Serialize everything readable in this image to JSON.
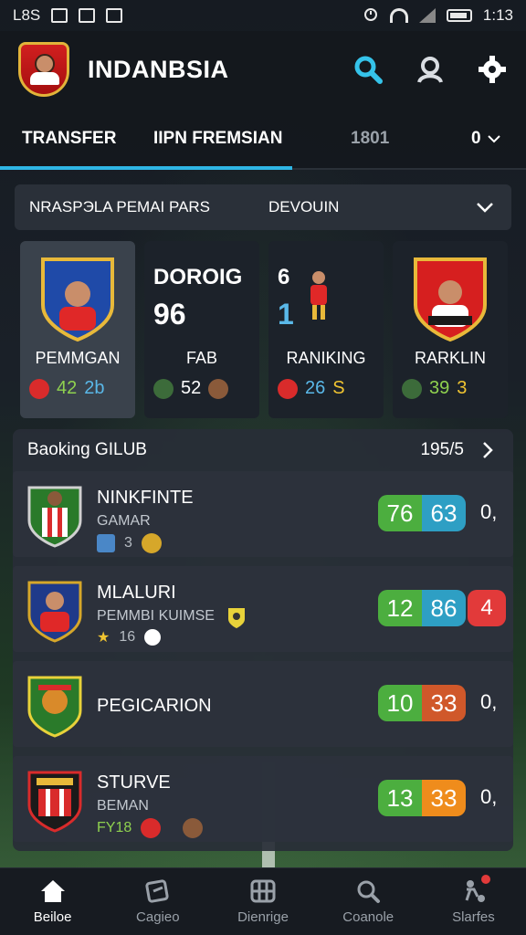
{
  "status_bar": {
    "left_text": "L8S",
    "time": "1:13"
  },
  "header": {
    "title": "INDANBSIA"
  },
  "tabs": [
    {
      "label": "TRANSFER",
      "active": true
    },
    {
      "label": "IIPN FREMSIAN",
      "active": false
    },
    {
      "label": "1801",
      "active": false
    },
    {
      "label": "0",
      "active": false
    }
  ],
  "filter": {
    "label": "NRASPЭLA PEMAI PARS",
    "value": "DEVOUIN"
  },
  "cards": [
    {
      "label": "PEMMGAN",
      "stat1": "42",
      "stat2": "2b"
    },
    {
      "big1": "DOROIG",
      "big2": "96",
      "label": "FAB",
      "stat1": "52"
    },
    {
      "big1": "6",
      "big2": "1",
      "label": "RANIKING",
      "stat1": "26",
      "stat2": "S"
    },
    {
      "label": "RARKLIN",
      "stat1": "39",
      "stat2": "3"
    }
  ],
  "ranking": {
    "title": "Baoking GILUB",
    "count": "195/5",
    "rows": [
      {
        "name": "NINKFINTE",
        "sub": "GAMAR",
        "meta": "3",
        "score1": "76",
        "score2": "63",
        "extra": "0,"
      },
      {
        "name": "MLALURI",
        "sub": "PEMMBI KUIMSE",
        "meta": "16",
        "score1": "12",
        "score2": "86",
        "extra": "4"
      },
      {
        "name": "PEGICARION",
        "score1": "10",
        "score2": "33",
        "extra": "0,"
      },
      {
        "name": "STURVE",
        "sub": "BEMAN",
        "meta": "FY18",
        "score1": "13",
        "score2": "33",
        "extra": "0,"
      }
    ]
  },
  "nav": [
    {
      "label": "Beiloe",
      "active": true
    },
    {
      "label": "Cagieo",
      "active": false
    },
    {
      "label": "Dienrige",
      "active": false
    },
    {
      "label": "Coanole",
      "active": false
    },
    {
      "label": "Slarfes",
      "active": false
    }
  ],
  "colors": {
    "accent": "#2fb6e5",
    "green": "#4cae3f",
    "blue": "#2e9fc4",
    "orange": "#ef8c1c",
    "red": "#e23a3a"
  }
}
